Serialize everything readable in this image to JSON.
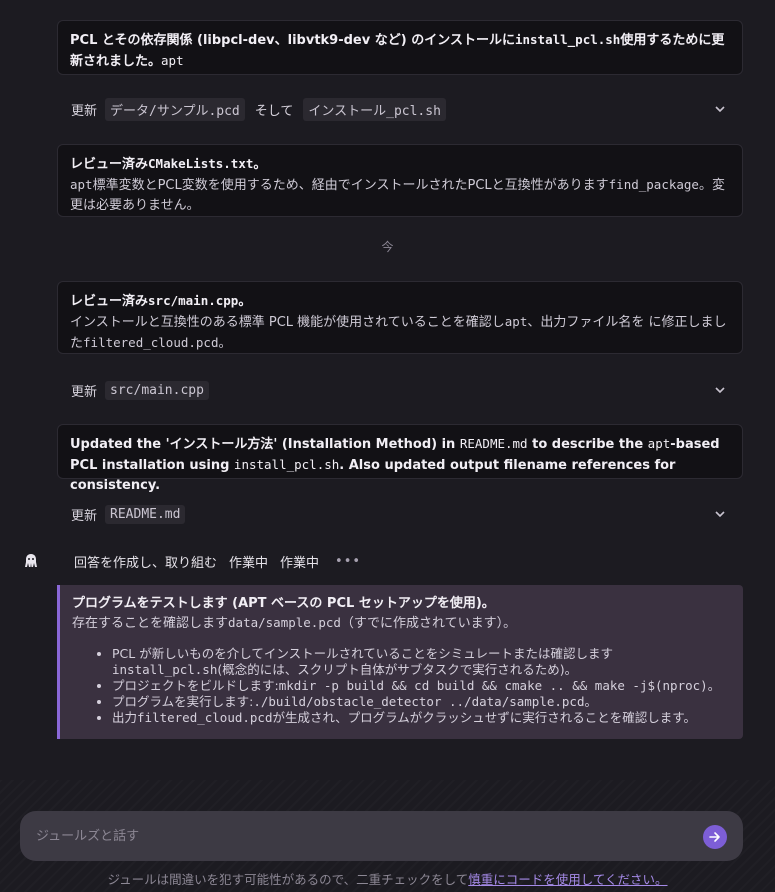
{
  "cards": {
    "install": {
      "title_a": "PCL とその依存関係 (libpcl-dev、libvtk9-dev など) のインストールに",
      "title_mono": "install_pcl.sh",
      "title_b": "使用するために更新されました。",
      "title_c": "apt"
    },
    "cmake": {
      "title_a": "レビュー済み",
      "title_mono": "CMakeLists.txt",
      "title_b": "。",
      "body_a": "apt",
      "body_b": "標準変数とPCL変数を使用するため、経由でインストールされたPCLと互換性があります",
      "body_mono": "find_package",
      "body_c": "。変更は必要ありません。"
    },
    "main_cpp": {
      "title_a": "レビュー済み",
      "title_mono": "src/main.cpp",
      "title_b": "。",
      "body_a": "インストールと互換性のある標準 PCL 機能が使用されていることを確認し",
      "body_mono1": "apt",
      "body_b": "、出力ファイル名を に修正しました",
      "body_mono2": "filtered_cloud.pcd",
      "body_c": "。"
    },
    "readme": {
      "text_a": "Updated the 'インストール方法' (Installation Method) in ",
      "mono1": "README.md",
      "text_b": " to describe the ",
      "mono2": "apt",
      "text_c": "-based PCL installation using ",
      "mono3": "install_pcl.sh",
      "text_d": ". Also updated output filename references for consistency."
    }
  },
  "updates": {
    "label": "更新",
    "and_label": "そして",
    "row1": {
      "chip1": "データ/サンプル.pcd",
      "chip2": "インストール_pcl.sh"
    },
    "row2": {
      "chip1": "src/main.cpp"
    },
    "row3": {
      "chip1": "README.md"
    }
  },
  "now_label": "今",
  "agent": {
    "status_text": "回答を作成し、取り組む",
    "tag1": "作業中",
    "tag2": "作業中",
    "more": "•••"
  },
  "plan": {
    "title": "プログラムをテストします (APT ベースの PCL セットアップを使用)。",
    "body_a": "存在することを確認します",
    "body_mono": "data/sample.pcd",
    "body_b": "（すでに作成されています）。",
    "items": [
      {
        "a": "PCL が新しいものを介してインストールされていることをシミュレートまたは確認します",
        "m": "install_pcl.sh",
        "b": "(概念的には、スクリプト自体がサブタスクで実行されるため)。"
      },
      {
        "a": "プロジェクトをビルドします:",
        "m": "mkdir -p build && cd build && cmake .. && make -j$(nproc)",
        "b": "。"
      },
      {
        "a": "プログラムを実行します:",
        "m": "./build/obstacle_detector ../data/sample.pcd",
        "b": "。"
      },
      {
        "a": "出力",
        "m": "filtered_cloud.pcd",
        "b": "が生成され、プログラムがクラッシュせずに実行されることを確認します。"
      }
    ]
  },
  "input": {
    "placeholder": "ジュールズと話す"
  },
  "footer": {
    "text": "ジュールは間違いを犯す可能性があるので、二重チェックをして",
    "link": "慎重にコードを使用してください。"
  },
  "colors": {
    "accent": "#7d5ed6",
    "plan_border": "#8a68d8",
    "plan_bg": "#3a3140"
  }
}
